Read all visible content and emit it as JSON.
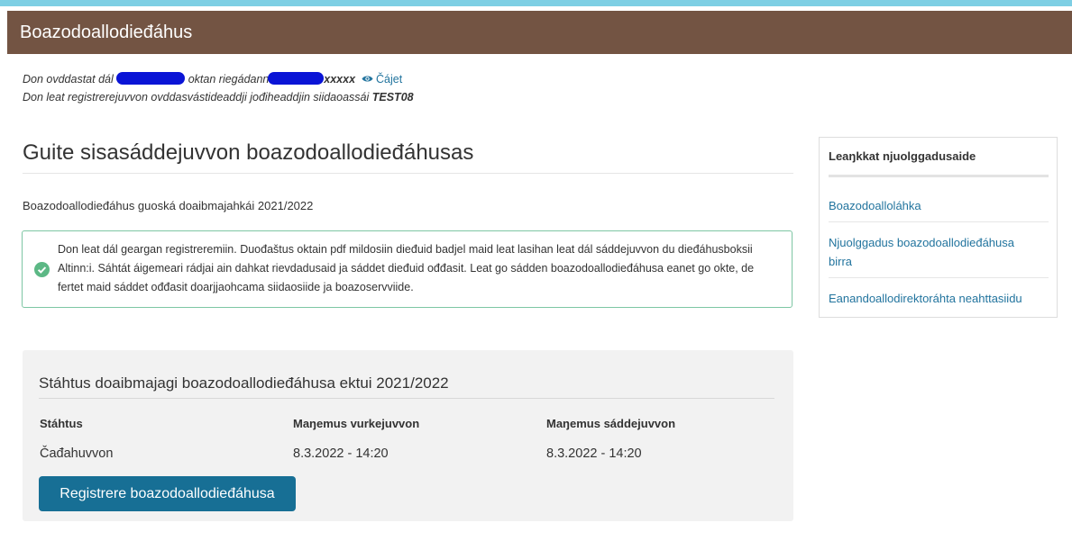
{
  "header": {
    "title": "Boazodoallodieđáhus"
  },
  "info": {
    "line1_prefix": "Don ovddastat dál",
    "line1_mid": "oktan riegádannummáriin",
    "line1_masked": "xxxxx",
    "line1_link": "Čájet",
    "line2_prefix": "Don leat registrerejuvvon ovddasvástideaddji jođiheaddjin siidaoassái",
    "line2_code": "TEST08"
  },
  "main": {
    "title": "Guite sisasáddejuvvon boazodoallodieđáhusas",
    "period": "Boazodoallodieđáhus guoská doaibmajahkái 2021/2022",
    "notice": "Don leat dál geargan registreremiin. Duođaštus oktain pdf mildosiin dieđuid badjel maid leat lasihan leat dál sáddejuvvon du dieđáhusboksii Altinn:i. Sáhtát áigemeari rádjai ain dahkat rievdadusaid ja sáddet dieđuid ođđasit. Leat go sádden boazodoallodieđáhusa eanet go okte, de fertet maid sáddet ođđasit doarjjaohcama siidaosiide ja boazoservviide."
  },
  "status": {
    "title": "Stáhtus doaibmajagi boazodoallodieđáhusa ektui 2021/2022",
    "headers": [
      "Stáhtus",
      "Maŋemus vurkejuvvon",
      "Maŋemus sáddejuvvon"
    ],
    "values": [
      "Čađahuvvon",
      "8.3.2022 - 14:20",
      "8.3.2022 - 14:20"
    ],
    "button": "Registrere boazodoallodieđáhusa"
  },
  "sidebar": {
    "title": "Leaŋkkat njuolggadusaide",
    "links": [
      "Boazodoalloláhka",
      "Njuolggadus boazodoallodieđáhusa birra",
      "Eanandoallodirektoráhta neahttasiidu"
    ]
  },
  "colors": {
    "header_bg": "#735443",
    "accent": "#7ecfe4",
    "button": "#176f95",
    "link": "#22749e",
    "success": "#5cb885"
  },
  "icons": [
    "eye-icon",
    "check-circle-icon"
  ]
}
